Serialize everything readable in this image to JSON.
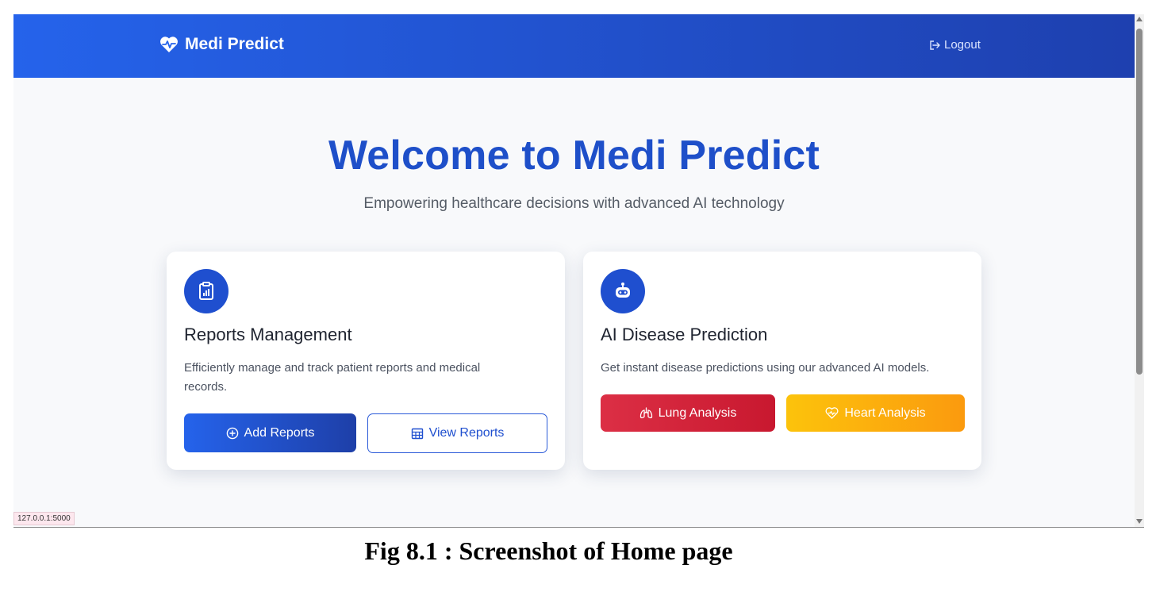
{
  "app": {
    "brand_name": "Medi Predict",
    "logout_label": "Logout",
    "brand_icon": "heart-pulse-icon",
    "logout_icon": "logout-icon"
  },
  "hero": {
    "title": "Welcome to Medi Predict",
    "subtitle": "Empowering healthcare decisions with advanced AI technology"
  },
  "cards": {
    "reports": {
      "icon": "clipboard-chart-icon",
      "title": "Reports Management",
      "description": "Efficiently manage and track patient reports and medical records.",
      "add_label": "Add Reports",
      "view_label": "View Reports"
    },
    "prediction": {
      "icon": "robot-icon",
      "title": "AI Disease Prediction",
      "description": "Get instant disease predictions using our advanced AI models.",
      "lung_label": "Lung Analysis",
      "heart_label": "Heart Analysis"
    }
  },
  "status_bar": {
    "url": "127.0.0.1:5000"
  },
  "caption": "Fig 8.1 : Screenshot of Home page",
  "colors": {
    "navbar_start": "#2563eb",
    "navbar_end": "#1e40af",
    "primary": "#1f4fcf",
    "lung_button": "#dc2f45",
    "heart_button": "#fcc30c"
  }
}
